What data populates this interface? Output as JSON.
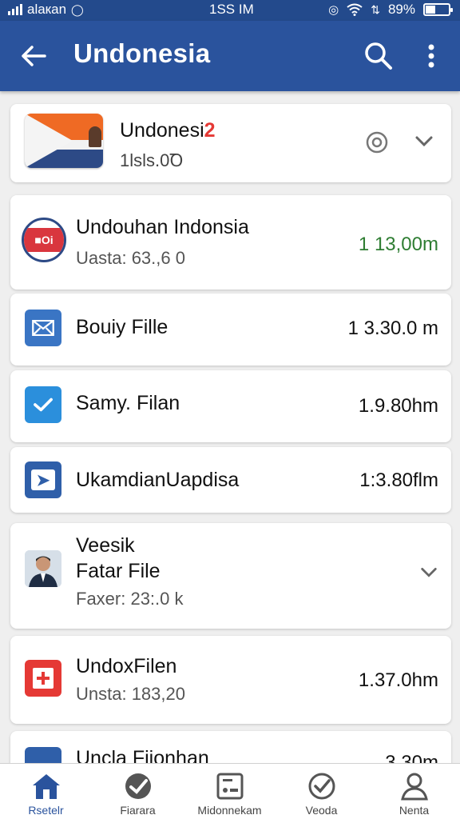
{
  "status_bar": {
    "carrier": "alaкan",
    "time": "1SS IM",
    "battery": "89%"
  },
  "app_bar": {
    "title": "Undonesia"
  },
  "header_card": {
    "title": "Undonesi",
    "badge": "2",
    "subtitle": "1lsls.0Ꝺ"
  },
  "rows": [
    {
      "title": "Undouhan Indonsia",
      "subtitle": "Uasta: 63.,6 0",
      "size": "1 13,00m"
    },
    {
      "title": "Bouiy Fille",
      "size": "1 3.30.0 m"
    },
    {
      "title": "Samy. Filan",
      "size": "1.9.80hm"
    },
    {
      "title": "UkamdianUapdisa",
      "size": "1:3.80flm"
    },
    {
      "title_line1": "Veesik",
      "title_line2": "Fatar File",
      "subtitle": "Faxer: 23:.0 k"
    },
    {
      "title": "UndoxFilen",
      "subtitle": "Unsta: 183,20",
      "size": "1.37.0hm"
    },
    {
      "title": "Uncla Fiionhan",
      "size": "3.30m"
    }
  ],
  "bottom_nav": [
    {
      "label": "Rsetelr",
      "icon": "home-icon"
    },
    {
      "label": "Fiarara",
      "icon": "check-badge-icon"
    },
    {
      "label": "Midonnekam",
      "icon": "card-icon"
    },
    {
      "label": "Veoda",
      "icon": "check-circle-icon"
    },
    {
      "label": "Nenta",
      "icon": "person-icon"
    }
  ],
  "colors": {
    "primary": "#2a539d",
    "status_bar": "#234a8c",
    "size_green": "#2e7d32",
    "background": "#efefef"
  }
}
